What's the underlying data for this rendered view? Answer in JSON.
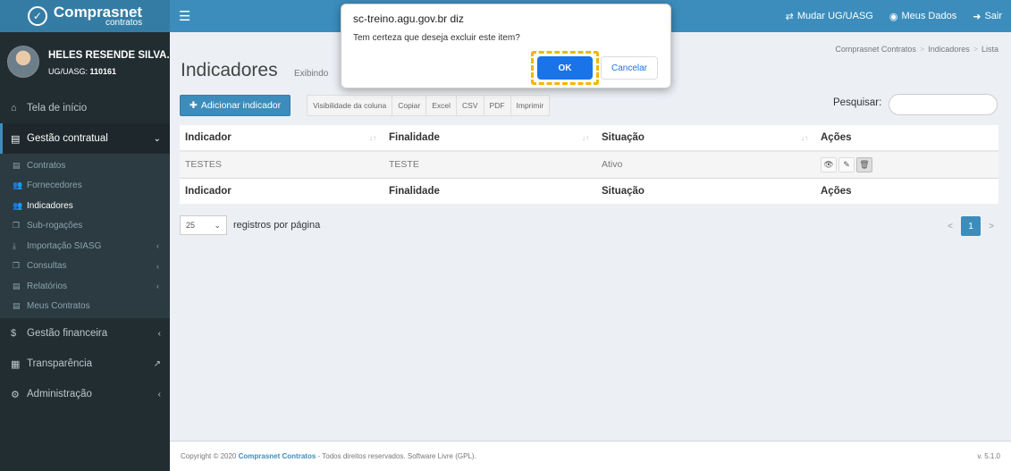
{
  "header": {
    "logo_main": "Comprasnet",
    "logo_sub": "contratos",
    "menu_icon": "hamburger-icon",
    "links": [
      {
        "icon": "exchange-icon",
        "label": "Mudar UG/UASG"
      },
      {
        "icon": "user-circle-icon",
        "label": "Meus Dados"
      },
      {
        "icon": "sign-out-icon",
        "label": "Sair"
      }
    ]
  },
  "user": {
    "name": "HELES RESENDE SILVA...",
    "ug_label": "UG/UASG:",
    "ug_value": "110161"
  },
  "sidebar": {
    "home": "Tela de início",
    "gestao_contratual": "Gestão contratual",
    "sub_items": [
      {
        "label": "Contratos",
        "icon": "file-icon"
      },
      {
        "label": "Fornecedores",
        "icon": "users-icon"
      },
      {
        "label": "Indicadores",
        "icon": "users-icon"
      },
      {
        "label": "Sub-rogações",
        "icon": "copy-icon"
      },
      {
        "label": "Importação SIASG",
        "icon": "download-icon"
      },
      {
        "label": "Consultas",
        "icon": "copy-icon"
      },
      {
        "label": "Relatórios",
        "icon": "file-icon"
      },
      {
        "label": "Meus Contratos",
        "icon": "file-icon"
      }
    ],
    "gestao_financeira": "Gestão financeira",
    "transparencia": "Transparência",
    "administracao": "Administração"
  },
  "page": {
    "title": "Indicadores",
    "subtitle": "Exibindo",
    "breadcrumb": [
      "Comprasnet Contratos",
      "Indicadores",
      "Lista"
    ]
  },
  "toolbar": {
    "add_label": "Adicionar indicador",
    "buttons": [
      "Visibilidade da coluna",
      "Copiar",
      "Excel",
      "CSV",
      "PDF",
      "Imprimir"
    ],
    "search_label": "Pesquisar:",
    "search_value": ""
  },
  "table": {
    "columns": [
      "Indicador",
      "Finalidade",
      "Situação",
      "Ações"
    ],
    "rows": [
      {
        "indicador": "TESTES",
        "finalidade": "TESTE",
        "situacao": "Ativo"
      }
    ]
  },
  "pagination": {
    "per_page": "25",
    "per_page_label": "registros por página",
    "prev": "<",
    "current": "1",
    "next": ">"
  },
  "footer": {
    "copyright_prefix": "Copyright © 2020",
    "brand": "Comprasnet Contratos",
    "copyright_suffix": "- Todos direitos reservados. Software Livre (GPL).",
    "version": "v. 5.1.0"
  },
  "dialog": {
    "origin": "sc-treino.agu.gov.br diz",
    "message": "Tem certeza que deseja excluir este item?",
    "ok": "OK",
    "cancel": "Cancelar"
  },
  "colors": {
    "primary": "#3c8dbc",
    "sidebar": "#222d32",
    "dialog_ok": "#1a73e8",
    "highlight": "#f1b600"
  }
}
